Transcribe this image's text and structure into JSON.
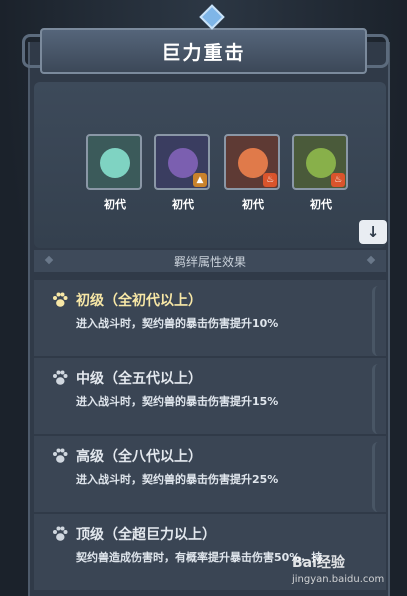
{
  "title": "巨力重击",
  "pets": [
    {
      "gen_label": "初代",
      "color": "#7fd3c2",
      "badge": ""
    },
    {
      "gen_label": "初代",
      "color": "#7b5fb0",
      "badge": "▲"
    },
    {
      "gen_label": "初代",
      "color": "#e07a4a",
      "badge": "♨"
    },
    {
      "gen_label": "初代",
      "color": "#88b04a",
      "badge": "♨"
    }
  ],
  "sort_icon": "arrow-down-icon",
  "section_title": "羁绊属性效果",
  "tiers": [
    {
      "name": "初级（全初代以上）",
      "desc": "进入战斗时，契约兽的暴击伤害提升10%",
      "active": true
    },
    {
      "name": "中级（全五代以上）",
      "desc": "进入战斗时，契约兽的暴击伤害提升15%",
      "active": false
    },
    {
      "name": "高级（全八代以上）",
      "desc": "进入战斗时，契约兽的暴击伤害提升25%",
      "active": false
    },
    {
      "name": "顶级（全超巨力以上）",
      "desc": "契约兽造成伤害时，有概率提升暴击伤害50%，持",
      "active": false
    }
  ],
  "watermark": "Bai经验",
  "watermark_url": "jingyan.baidu.com"
}
